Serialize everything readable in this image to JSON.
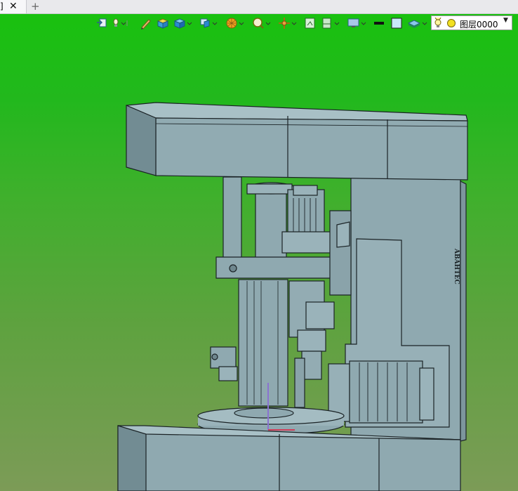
{
  "tabs": [
    {
      "label": "]",
      "close_icon": "close-icon"
    }
  ],
  "new_tab": {
    "icon": "plus-icon",
    "label": "+"
  },
  "toolbar": {
    "items": [
      "import-icon",
      "light-icon",
      "pencil-icon",
      "box-icon",
      "cube-icon",
      "views-icon",
      "render-ball-icon",
      "zoom-icon",
      "pan-icon",
      "fit-icon",
      "section-icon",
      "display-icon",
      "line-color-icon",
      "fill-color-icon",
      "layer-stack-icon"
    ],
    "layer": {
      "lamp_icon": "bulb-icon",
      "sun_icon": "color-dot-icon",
      "value": "图层0000",
      "arrow": "▼"
    }
  },
  "model": {
    "label": "ABAHTEC"
  },
  "colors": {
    "gradient_top": "#19c10f",
    "gradient_bottom": "#7c9b57",
    "part_fill": "#8ea8af",
    "part_stroke": "#1b2326"
  }
}
